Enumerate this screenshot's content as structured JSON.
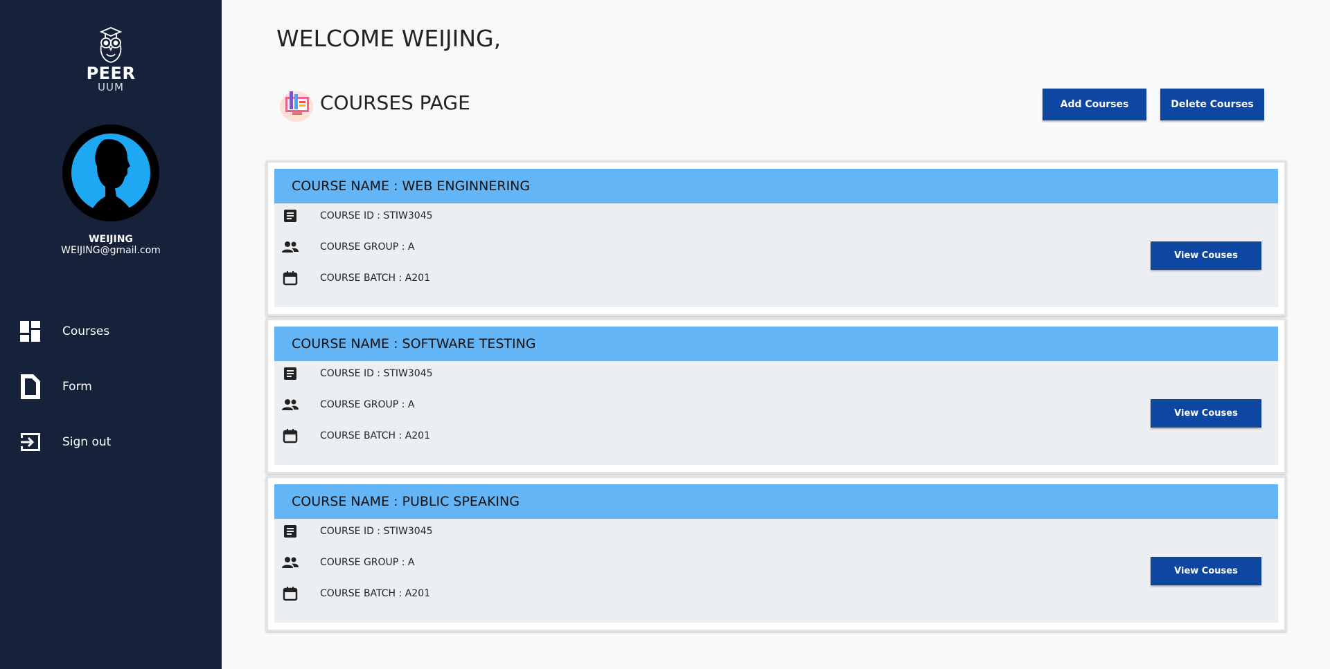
{
  "sidebar": {
    "logo": {
      "title": "PEER",
      "subtitle": "UUM"
    },
    "user": {
      "name": "WEIJING",
      "email": "WEIJING@gmail.com"
    },
    "nav": [
      {
        "label": "Courses",
        "icon": "dashboard-icon"
      },
      {
        "label": "Form",
        "icon": "form-icon"
      },
      {
        "label": "Sign out",
        "icon": "sign-out-icon"
      }
    ]
  },
  "header": {
    "welcome": "WELCOME WEIJING,",
    "page_title": "COURSES PAGE",
    "add_button": "Add Courses",
    "delete_button": "Delete Courses"
  },
  "courses": [
    {
      "name": "COURSE NAME : WEB ENGINNERING",
      "id": "COURSE ID : STIW3045",
      "group": "COURSE GROUP : A",
      "batch": "COURSE BATCH : A201",
      "button": "View Couses"
    },
    {
      "name": "COURSE NAME : SOFTWARE TESTING",
      "id": "COURSE ID : STIW3045",
      "group": "COURSE GROUP : A",
      "batch": "COURSE BATCH : A201",
      "button": "View Couses"
    },
    {
      "name": "COURSE NAME : PUBLIC SPEAKING",
      "id": "COURSE ID : STIW3045",
      "group": "COURSE GROUP : A",
      "batch": "COURSE BATCH : A201",
      "button": "View Couses"
    }
  ],
  "colors": {
    "sidebar_bg": "#16213a",
    "primary_button": "#0d47a1",
    "card_header": "#64b5f6",
    "card_body": "#eceff1",
    "avatar_accent": "#1ea7f2"
  }
}
